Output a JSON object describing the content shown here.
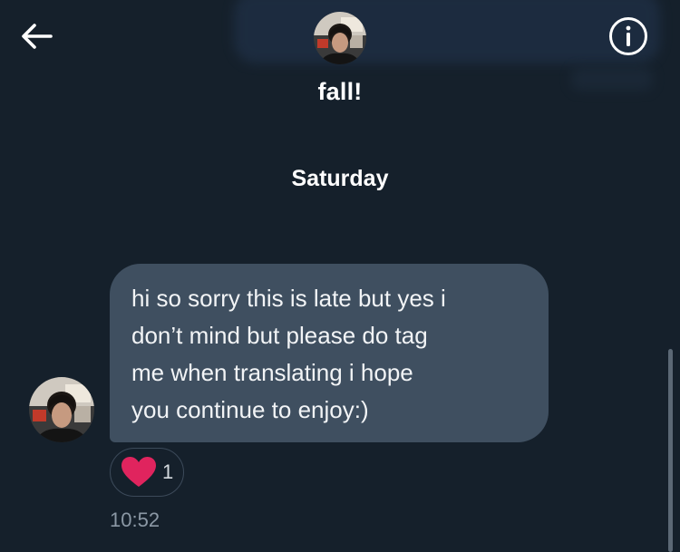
{
  "header": {
    "back_icon": "arrow-left-icon",
    "info_icon": "info-circle-icon",
    "title": "fall!"
  },
  "conversation": {
    "day_divider": "Saturday",
    "message": {
      "text": "hi so sorry this is late but yes i\ndon’t mind but please do tag\nme when translating i hope\nyou continue to enjoy:)",
      "reaction": {
        "icon": "heart-icon",
        "count": "1"
      },
      "time": "10:52"
    }
  },
  "colors": {
    "background": "#15202b",
    "bubble": "#3f4f60",
    "heart": "#f91880",
    "muted_text": "#8b98a5"
  }
}
